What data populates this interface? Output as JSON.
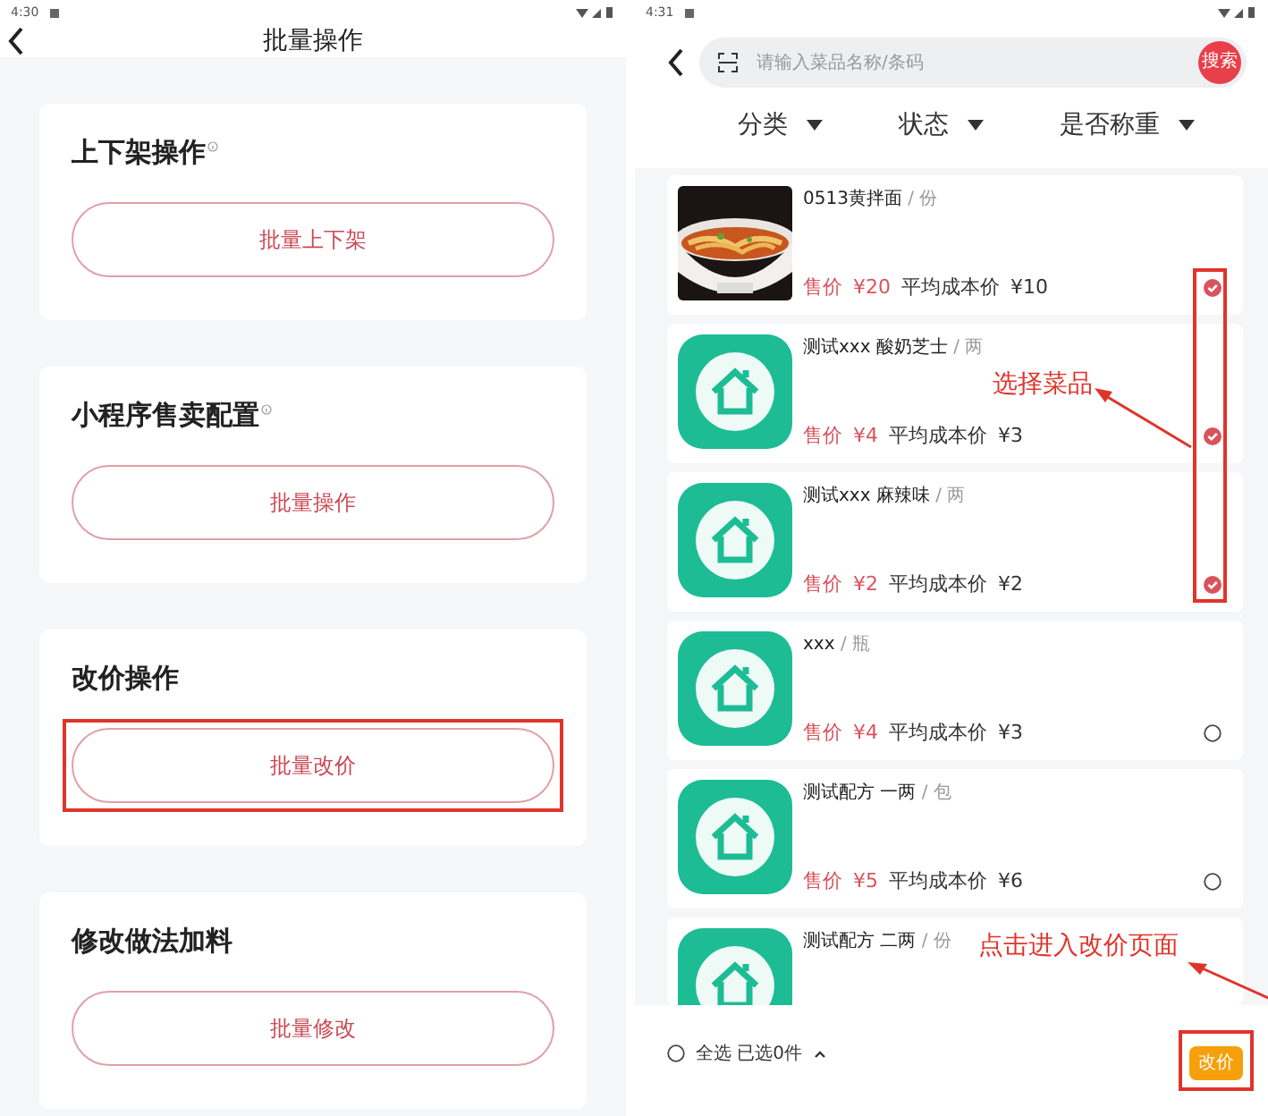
{
  "left": {
    "status_bar": {
      "time": "4:30"
    },
    "title": "批量操作",
    "sections": [
      {
        "title": "上下架操作",
        "info": true,
        "button": "批量上下架",
        "highlighted": false
      },
      {
        "title": "小程序售卖配置",
        "info": true,
        "button": "批量操作",
        "highlighted": false
      },
      {
        "title": "改价操作",
        "info": false,
        "button": "批量改价",
        "highlighted": true
      },
      {
        "title": "修改做法加料",
        "info": false,
        "button": "批量修改",
        "highlighted": false
      }
    ]
  },
  "right": {
    "status_bar": {
      "time": "4:31"
    },
    "search": {
      "placeholder": "请输入菜品名称/条码",
      "button": "搜索"
    },
    "filters": [
      "分类",
      "状态",
      "是否称重"
    ],
    "items": [
      {
        "name": "0513黄拌面",
        "unit": "/ 份",
        "price_label": "售价",
        "price": "¥20",
        "cost_label": "平均成本价",
        "cost": "¥10",
        "selected": true
      },
      {
        "kind": "app-icon",
        "name": "测试xxx 酸奶芝士",
        "unit": "/ 两",
        "price_label": "售价",
        "price": "¥4",
        "cost_label": "平均成本价",
        "cost": "¥3",
        "selected": true
      },
      {
        "kind": "app-icon",
        "name": "测试xxx 麻辣味",
        "unit": "/ 两",
        "price_label": "售价",
        "price": "¥2",
        "cost_label": "平均成本价",
        "cost": "¥2",
        "selected": true
      },
      {
        "kind": "app-icon",
        "name": "xxx",
        "unit": "/ 瓶",
        "price_label": "售价",
        "price": "¥4",
        "cost_label": "平均成本价",
        "cost": "¥3",
        "selected": false
      },
      {
        "kind": "app-icon",
        "name": "测试配方 一两",
        "unit": "/ 包",
        "price_label": "售价",
        "price": "¥5",
        "cost_label": "平均成本价",
        "cost": "¥6",
        "selected": false
      },
      {
        "kind": "app-icon",
        "name": "测试配方 二两",
        "unit": "/ 份"
      }
    ],
    "footer": {
      "select_all": "全选 已选0件",
      "all_selected": false,
      "button": "改价"
    },
    "annotations": [
      {
        "kind": "select",
        "text": "选择菜品"
      },
      {
        "kind": "enter",
        "text": "点击进入改价页面"
      }
    ]
  }
}
